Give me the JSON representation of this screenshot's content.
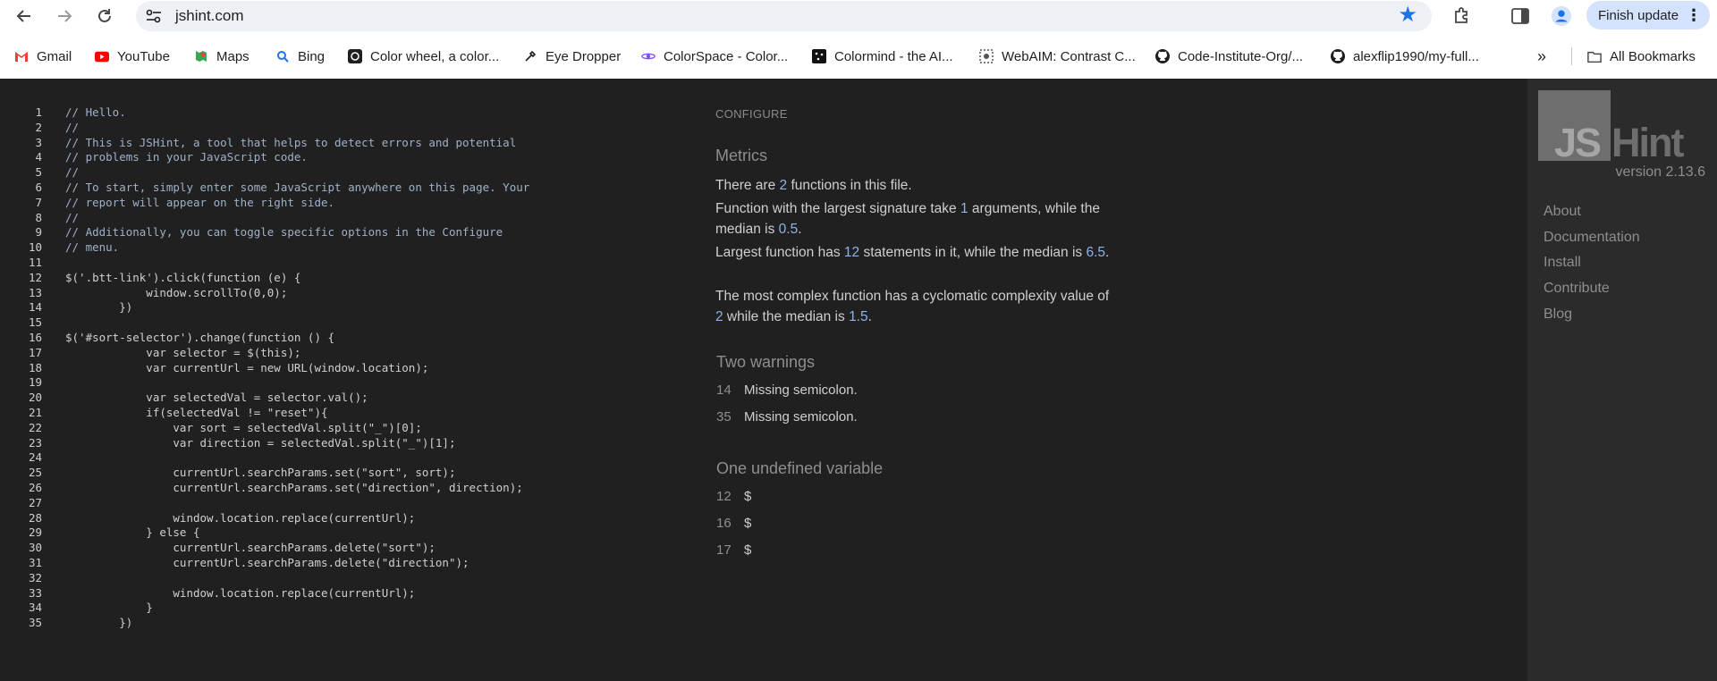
{
  "browser": {
    "url": "jshint.com",
    "finish_update_label": "Finish update",
    "all_bookmarks_label": "All Bookmarks",
    "bookmarks": [
      {
        "label": "Gmail",
        "icon": "gmail-icon"
      },
      {
        "label": "YouTube",
        "icon": "youtube-icon"
      },
      {
        "label": "Maps",
        "icon": "maps-icon"
      },
      {
        "label": "Bing",
        "icon": "bing-search-icon"
      },
      {
        "label": "Color wheel, a color...",
        "icon": "color-wheel-icon"
      },
      {
        "label": "Eye Dropper",
        "icon": "eye-dropper-icon"
      },
      {
        "label": "ColorSpace - Color...",
        "icon": "colorspace-icon"
      },
      {
        "label": "Colormind - the AI...",
        "icon": "colormind-icon"
      },
      {
        "label": "WebAIM: Contrast C...",
        "icon": "webaim-icon"
      },
      {
        "label": "Code-Institute-Org/...",
        "icon": "github-icon"
      },
      {
        "label": "alexflip1990/my-full...",
        "icon": "github-icon"
      }
    ],
    "accent_color": "#1a73e8"
  },
  "editor": {
    "line_numbers": [
      "1",
      "2",
      "3",
      "4",
      "5",
      "6",
      "7",
      "8",
      "9",
      "10",
      "11",
      "12",
      "13",
      "14",
      "15",
      "16",
      "17",
      "18",
      "19",
      "20",
      "21",
      "22",
      "23",
      "24",
      "25",
      "26",
      "27",
      "28",
      "29",
      "30",
      "31",
      "32",
      "33",
      "34",
      "35"
    ]
  },
  "report": {
    "configure_label": "CONFIGURE",
    "metrics_title": "Metrics",
    "metric_1_pre": "There are ",
    "metric_1_num": "2",
    "metric_1_post": " functions in this file.",
    "metric_2_pre": "Function with the largest signature take ",
    "metric_2_num": "1",
    "metric_2_mid": " arguments, while the median is ",
    "metric_2_num2": "0.5",
    "metric_2_post": ".",
    "metric_3_pre": "Largest function has ",
    "metric_3_num": "12",
    "metric_3_mid": " statements in it, while the median is ",
    "metric_3_num2": "6.5",
    "metric_3_post": ".",
    "metric_4_pre": "The most complex function has a cyclomatic complexity value of ",
    "metric_4_num": "2",
    "metric_4_mid": " while the median is ",
    "metric_4_num2": "1.5",
    "metric_4_post": ".",
    "warnings_title": "Two warnings",
    "warnings": [
      {
        "line": "14",
        "message": "Missing semicolon."
      },
      {
        "line": "35",
        "message": "Missing semicolon."
      }
    ],
    "undefined_title": "One undefined variable",
    "undefined": [
      {
        "line": "12",
        "name": "$"
      },
      {
        "line": "16",
        "name": "$"
      },
      {
        "line": "17",
        "name": "$"
      }
    ]
  },
  "sidebar": {
    "logo_js": "JS",
    "logo_hint": "Hint",
    "version": "version 2.13.6",
    "nav": [
      "About",
      "Documentation",
      "Install",
      "Contribute",
      "Blog"
    ]
  }
}
